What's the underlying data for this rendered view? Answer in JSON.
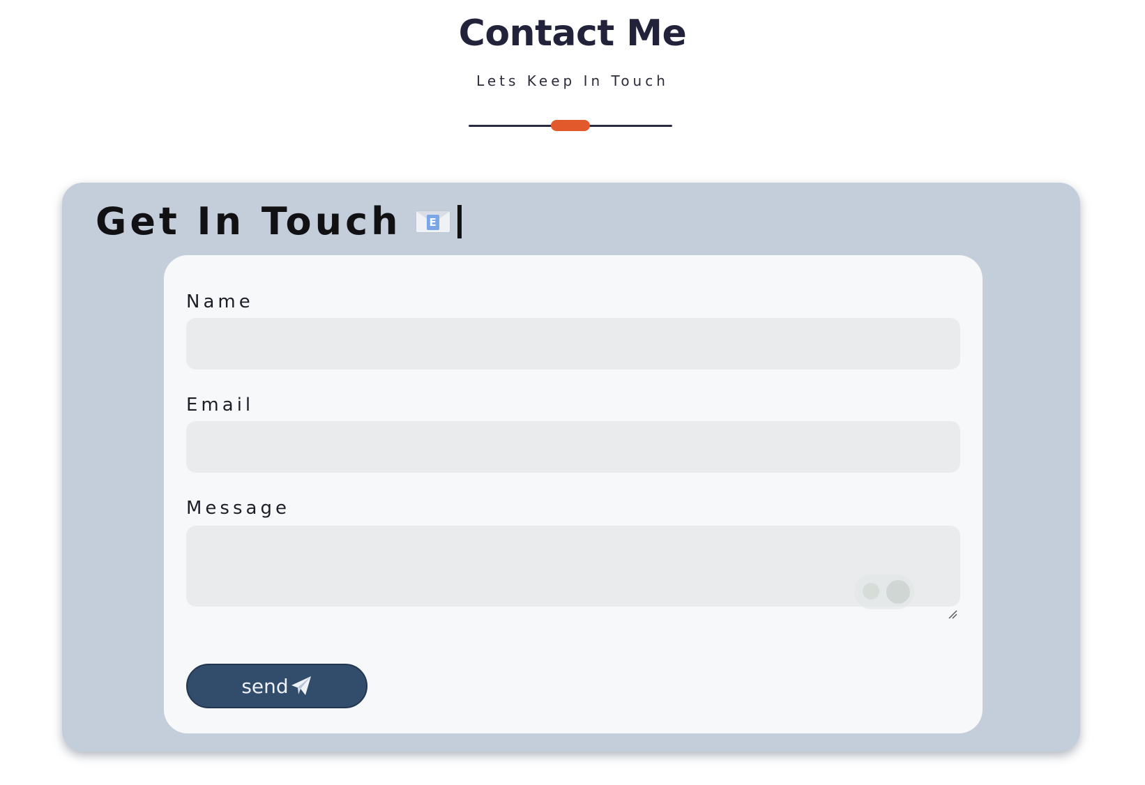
{
  "header": {
    "title": "Contact Me",
    "subtitle": "Lets Keep In Touch"
  },
  "card": {
    "title": "Get In Touch",
    "title_icon": "envelope-icon",
    "icon_badge": "E"
  },
  "form": {
    "name_label": "Name",
    "name_value": "",
    "email_label": "Email",
    "email_value": "",
    "message_label": "Message",
    "message_value": "",
    "send_label": "send",
    "send_icon": "paper-plane-icon"
  },
  "colors": {
    "accent": "#e25a2c",
    "title": "#22223a",
    "card_background": "#c3ceda",
    "panel_background": "#f7f8fa",
    "input_background": "#e9ebed",
    "button_background": "#324c6b"
  }
}
